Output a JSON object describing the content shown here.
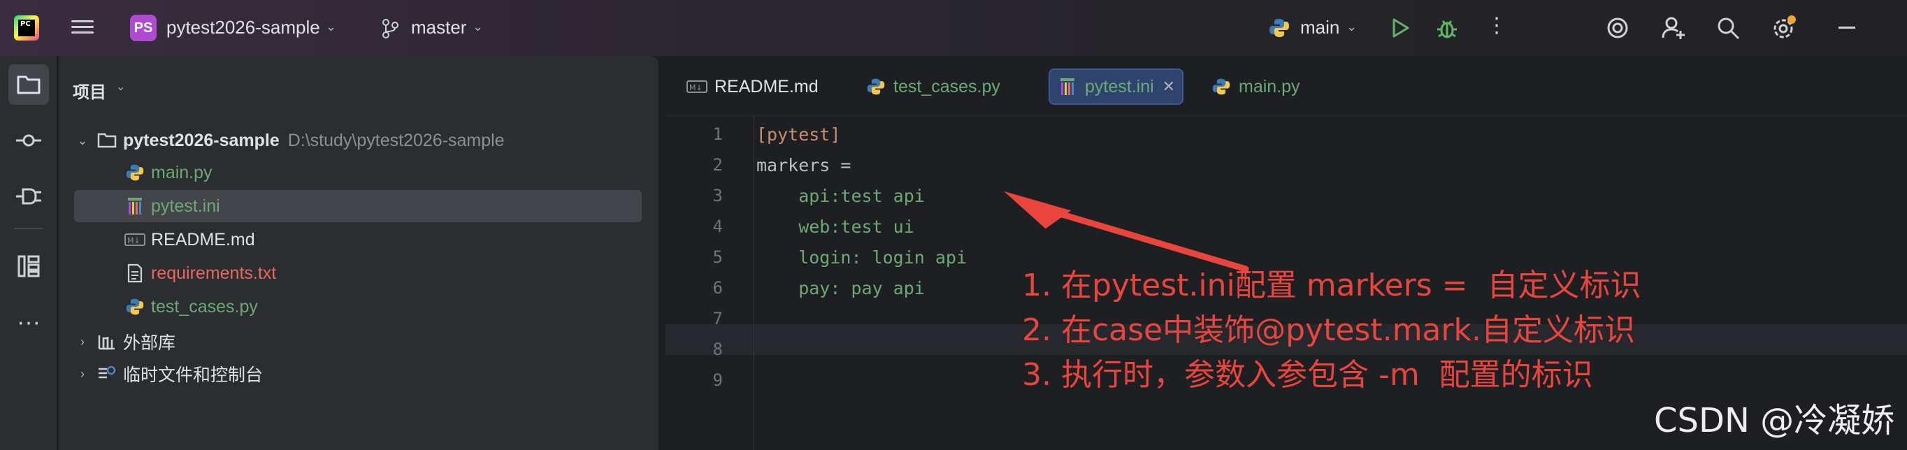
{
  "titlebar": {
    "logo_text": "PC",
    "project_badge": "PS",
    "project_name": "pytest2026-sample",
    "branch": "master",
    "run_config": "main",
    "colors": {
      "badge": "#b04ad0",
      "run": "#5fb865",
      "debug": "#5fb865",
      "notify_dot": "#f0a732"
    }
  },
  "project_panel": {
    "title": "项目",
    "root": {
      "name": "pytest2026-sample",
      "path": "D:\\study\\pytest2026-sample"
    },
    "files": [
      {
        "name": "main.py",
        "icon": "python-icon",
        "color": "#6aab73"
      },
      {
        "name": "pytest.ini",
        "icon": "pytest-ini-icon",
        "color": "#6aab73",
        "selected": true
      },
      {
        "name": "README.md",
        "icon": "markdown-icon",
        "color": "#dfe1e5"
      },
      {
        "name": "requirements.txt",
        "icon": "text-file-icon",
        "color": "#e8685a"
      },
      {
        "name": "test_cases.py",
        "icon": "python-icon",
        "color": "#6aab73"
      }
    ],
    "external_libs": "外部库",
    "scratches": "临时文件和控制台"
  },
  "tabs": [
    {
      "label": "README.md",
      "icon": "markdown-icon",
      "color": "#dfe1e5"
    },
    {
      "label": "test_cases.py",
      "icon": "python-icon",
      "color": "#6aab73"
    },
    {
      "label": "pytest.ini",
      "icon": "pytest-ini-icon",
      "color": "#6aab73",
      "active": true,
      "close": "✕"
    },
    {
      "label": "main.py",
      "icon": "python-icon",
      "color": "#6aab73"
    }
  ],
  "editor": {
    "line_numbers": [
      "1",
      "2",
      "3",
      "4",
      "5",
      "6",
      "7",
      "8",
      "9"
    ],
    "lines": [
      {
        "text": "[pytest]",
        "kind": "section"
      },
      {
        "text": "markers =",
        "kind": "key"
      },
      {
        "text": "    api:test api",
        "kind": "val"
      },
      {
        "text": "    web:test ui",
        "kind": "val"
      },
      {
        "text": "    login: login api",
        "kind": "val"
      },
      {
        "text": "    pay: pay api",
        "kind": "val"
      },
      {
        "text": "",
        "kind": "val"
      },
      {
        "text": "",
        "kind": "val"
      },
      {
        "text": "",
        "kind": "val"
      }
    ]
  },
  "annotation": {
    "lines": [
      "1. 在pytest.ini配置 markers =  自定义标识",
      "2. 在case中装饰@pytest.mark.自定义标识",
      "3. 执行时，参数入参包含 -m  配置的标识"
    ],
    "color": "#e8463c"
  },
  "watermark": "CSDN @冷凝娇"
}
